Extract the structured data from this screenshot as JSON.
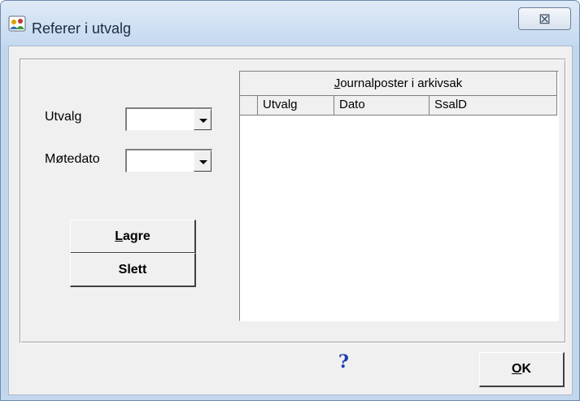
{
  "window": {
    "title": "Referer i utvalg",
    "close_glyph": "⊠",
    "app_icon": "people-icon"
  },
  "form": {
    "utvalg_label": "Utvalg",
    "utvalg_value": "",
    "motedato_label": "Møtedato",
    "motedato_value": ""
  },
  "buttons": {
    "lagre_label": "Lagre",
    "lagre_mnemonic": "L",
    "slett_label": "Slett",
    "ok_label": "OK",
    "ok_mnemonic": "O"
  },
  "grid": {
    "caption": "Journalposter i arkivsak",
    "caption_mnemonic": "J",
    "columns": [
      "",
      "Utvalg",
      "Dato",
      "SsalD"
    ],
    "rows": []
  },
  "help": {
    "glyph": "?",
    "icon": "help-icon"
  },
  "colors": {
    "titlebar": "#c5d9ef",
    "dialog_bg": "#f0f0f0",
    "help_blue": "#1a3cb5"
  }
}
